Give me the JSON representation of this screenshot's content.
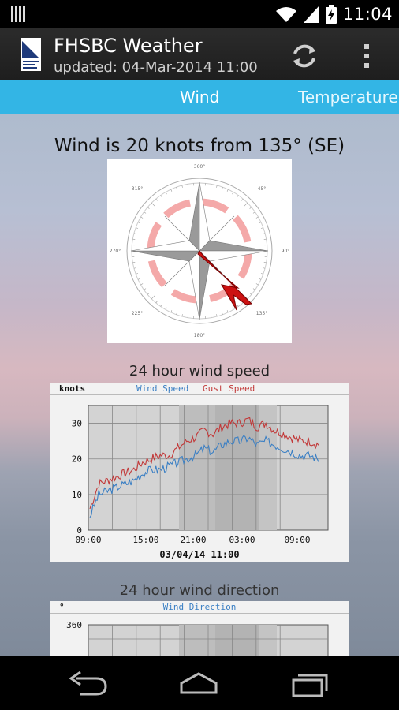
{
  "status_bar": {
    "time": "11:04"
  },
  "action_bar": {
    "title": "FHSBC Weather",
    "subtitle": "updated: 04-Mar-2014 11:00"
  },
  "tabs": [
    {
      "label": "Wind",
      "selected": true
    },
    {
      "label": "Temperature",
      "selected": false
    }
  ],
  "wind": {
    "headline": "Wind is 20 knots from 135° (SE)",
    "direction_deg": 135,
    "compass_labels": [
      "360°",
      "45°",
      "90°",
      "135°",
      "180°",
      "225°",
      "270°",
      "315°"
    ]
  },
  "speed_chart": {
    "title": "24 hour wind speed",
    "unit_label": "knots",
    "legend": [
      {
        "name": "Wind Speed",
        "color": "#3a7fc4"
      },
      {
        "name": "Gust Speed",
        "color": "#c23838"
      }
    ],
    "date_label": "03/04/14 11:00"
  },
  "direction_chart": {
    "title": "24 hour wind direction",
    "unit_label": "°",
    "legend_label": "Wind Direction",
    "first_tick": "360"
  },
  "chart_data": [
    {
      "type": "line",
      "title": "24 hour wind speed",
      "ylabel": "knots",
      "x_ticks": [
        "09:00",
        "15:00",
        "21:00",
        "03:00",
        "09:00"
      ],
      "y_ticks": [
        0,
        10,
        20,
        30
      ],
      "ylim": [
        0,
        35
      ],
      "xlabel": "03/04/14 11:00",
      "legend_placement": "top",
      "grid": true,
      "x": [
        "09:00",
        "10:00",
        "11:00",
        "12:00",
        "13:00",
        "14:00",
        "15:00",
        "16:00",
        "17:00",
        "18:00",
        "19:00",
        "20:00",
        "21:00",
        "22:00",
        "23:00",
        "00:00",
        "01:00",
        "02:00",
        "03:00",
        "04:00",
        "05:00",
        "06:00",
        "07:00",
        "08:00",
        "09:00",
        "10:00",
        "11:00"
      ],
      "series": [
        {
          "name": "Wind Speed",
          "color": "#3a7fc4",
          "values": [
            4,
            10,
            11,
            12,
            13,
            14,
            16,
            17,
            17,
            18,
            19,
            20,
            21,
            23,
            22,
            24,
            25,
            25,
            26,
            24,
            25,
            24,
            23,
            22,
            21,
            21,
            20
          ]
        },
        {
          "name": "Gust Speed",
          "color": "#c23838",
          "values": [
            6,
            13,
            14,
            15,
            16,
            17,
            19,
            20,
            21,
            21,
            23,
            25,
            26,
            28,
            27,
            29,
            30,
            30,
            31,
            29,
            30,
            28,
            27,
            26,
            25,
            25,
            24
          ]
        }
      ]
    }
  ]
}
